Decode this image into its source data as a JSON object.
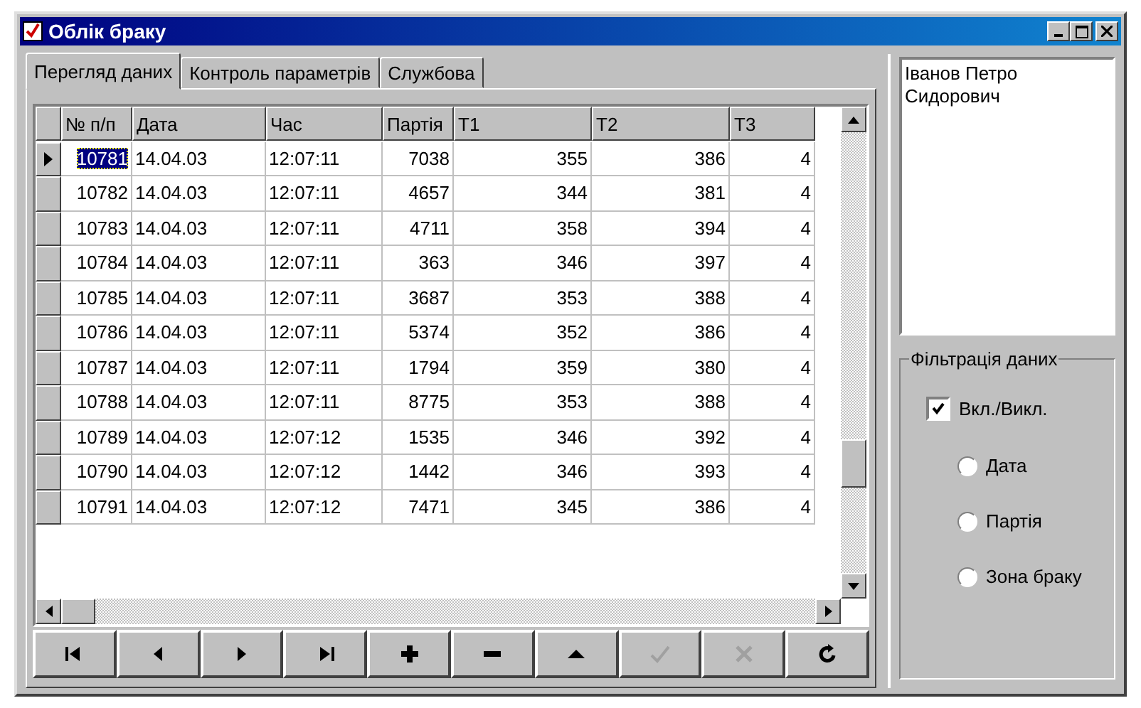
{
  "window": {
    "title": "Облік браку"
  },
  "tabs": [
    {
      "label": "Перегляд даних",
      "selected": true
    },
    {
      "label": "Контроль параметрів",
      "selected": false
    },
    {
      "label": "Службова",
      "selected": false
    }
  ],
  "table": {
    "columns": [
      "№ п/п",
      "Дата",
      "Час",
      "Партія",
      "T1",
      "T2",
      "T3"
    ],
    "rows": [
      {
        "selected": true,
        "cells": [
          "10781",
          "14.04.03",
          "12:07:11",
          "7038",
          "355",
          "386",
          "4"
        ]
      },
      {
        "selected": false,
        "cells": [
          "10782",
          "14.04.03",
          "12:07:11",
          "4657",
          "344",
          "381",
          "4"
        ]
      },
      {
        "selected": false,
        "cells": [
          "10783",
          "14.04.03",
          "12:07:11",
          "4711",
          "358",
          "394",
          "4"
        ]
      },
      {
        "selected": false,
        "cells": [
          "10784",
          "14.04.03",
          "12:07:11",
          "363",
          "346",
          "397",
          "4"
        ]
      },
      {
        "selected": false,
        "cells": [
          "10785",
          "14.04.03",
          "12:07:11",
          "3687",
          "353",
          "388",
          "4"
        ]
      },
      {
        "selected": false,
        "cells": [
          "10786",
          "14.04.03",
          "12:07:11",
          "5374",
          "352",
          "386",
          "4"
        ]
      },
      {
        "selected": false,
        "cells": [
          "10787",
          "14.04.03",
          "12:07:11",
          "1794",
          "359",
          "380",
          "4"
        ]
      },
      {
        "selected": false,
        "cells": [
          "10788",
          "14.04.03",
          "12:07:11",
          "8775",
          "353",
          "388",
          "4"
        ]
      },
      {
        "selected": false,
        "cells": [
          "10789",
          "14.04.03",
          "12:07:12",
          "1535",
          "346",
          "392",
          "4"
        ]
      },
      {
        "selected": false,
        "cells": [
          "10790",
          "14.04.03",
          "12:07:12",
          "1442",
          "346",
          "393",
          "4"
        ]
      },
      {
        "selected": false,
        "cells": [
          "10791",
          "14.04.03",
          "12:07:12",
          "7471",
          "345",
          "386",
          "4"
        ]
      }
    ]
  },
  "navigator": [
    {
      "kind": "first",
      "disabled": false
    },
    {
      "kind": "prior",
      "disabled": false
    },
    {
      "kind": "next",
      "disabled": false
    },
    {
      "kind": "last",
      "disabled": false
    },
    {
      "kind": "insert",
      "disabled": false
    },
    {
      "kind": "delete",
      "disabled": false
    },
    {
      "kind": "edit",
      "disabled": false
    },
    {
      "kind": "post",
      "disabled": true
    },
    {
      "kind": "cancel",
      "disabled": true
    },
    {
      "kind": "refresh",
      "disabled": false
    }
  ],
  "memo": {
    "value": "Іванов Петро Сидорович"
  },
  "filter": {
    "title": "Фільтрація даних",
    "toggle": {
      "label": "Вкл./Викл.",
      "checked": true
    },
    "options": [
      {
        "label": "Дата",
        "selected": false
      },
      {
        "label": "Партія",
        "selected": false
      },
      {
        "label": "Зона браку",
        "selected": false
      }
    ]
  }
}
